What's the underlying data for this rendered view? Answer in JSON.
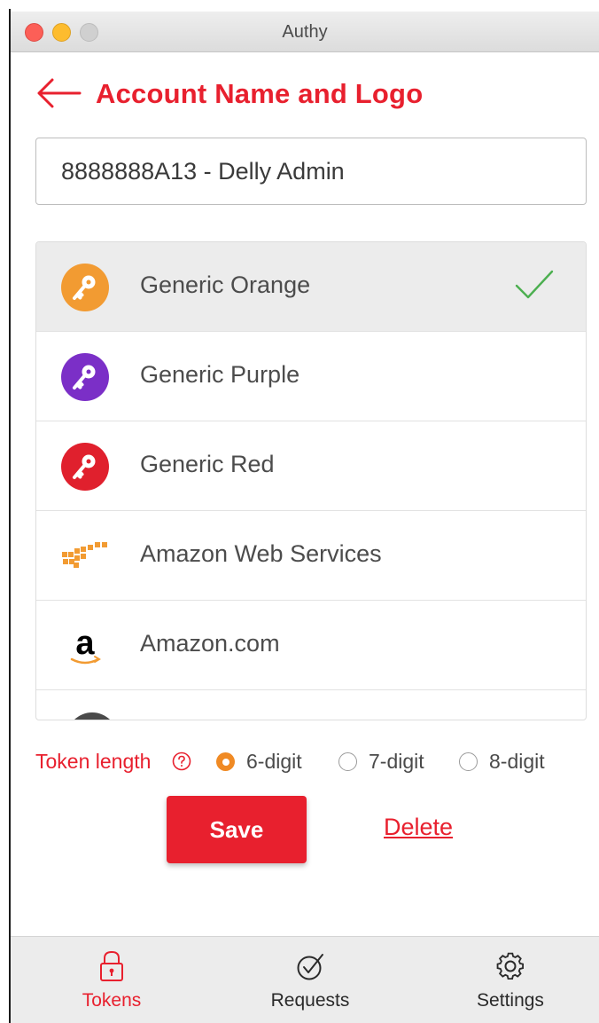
{
  "window": {
    "title": "Authy"
  },
  "header": {
    "title": "Account Name and Logo"
  },
  "account": {
    "name_value": "8888888A13 - Delly Admin"
  },
  "logos": [
    {
      "label": "Generic Orange",
      "icon": "key-orange-icon",
      "color": "#f29b32",
      "selected": true
    },
    {
      "label": "Generic Purple",
      "icon": "key-purple-icon",
      "color": "#7b2fc7",
      "selected": false
    },
    {
      "label": "Generic Red",
      "icon": "key-red-icon",
      "color": "#e0202d",
      "selected": false
    },
    {
      "label": "Amazon Web Services",
      "icon": "aws-logo-icon",
      "color": "#f29b32",
      "selected": false
    },
    {
      "label": "Amazon.com",
      "icon": "amazon-logo-icon",
      "color": "#000000",
      "selected": false
    }
  ],
  "token_length": {
    "label": "Token length",
    "options": [
      {
        "label": "6-digit",
        "checked": true
      },
      {
        "label": "7-digit",
        "checked": false
      },
      {
        "label": "8-digit",
        "checked": false
      }
    ]
  },
  "actions": {
    "save_label": "Save",
    "delete_label": "Delete"
  },
  "nav": {
    "tokens_label": "Tokens",
    "requests_label": "Requests",
    "settings_label": "Settings",
    "active": "Tokens"
  },
  "colors": {
    "accent": "#e8202e",
    "orange": "#f08a24",
    "check": "#4caf50"
  }
}
